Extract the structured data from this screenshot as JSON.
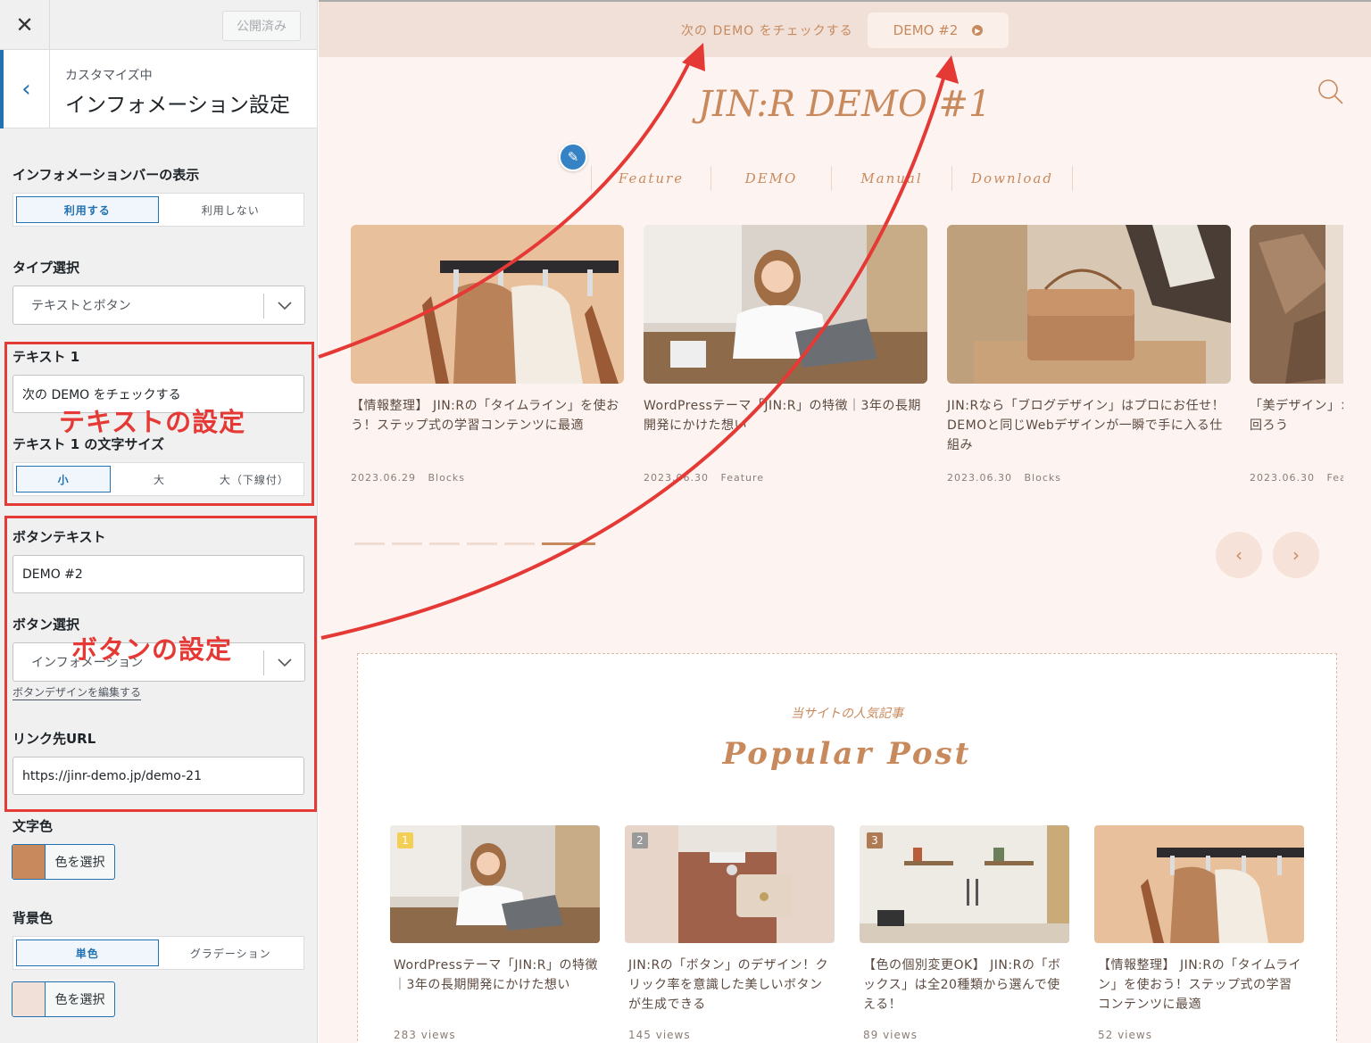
{
  "sidebar": {
    "close_icon": "close-icon",
    "publish_label": "公開済み",
    "customizing_label": "カスタマイズ中",
    "section_title": "インフォメーション設定",
    "info_bar_label": "インフォメーションバーの表示",
    "info_bar_options": [
      "利用する",
      "利用しない"
    ],
    "type_label": "タイプ選択",
    "type_value": "テキストとボタン",
    "text1_label": "テキスト 1",
    "text1_value": "次の DEMO をチェックする",
    "text1_size_label": "テキスト 1 の文字サイズ",
    "text1_size_options": [
      "小",
      "大",
      "大（下線付）"
    ],
    "button_text_label": "ボタンテキスト",
    "button_text_value": "DEMO #2",
    "button_select_label": "ボタン選択",
    "button_select_value": "インフォメーション",
    "edit_button_link": "ボタンデザインを編集する",
    "link_url_label": "リンク先URL",
    "link_url_value": "https://jinr-demo.jp/demo-21",
    "text_color_label": "文字色",
    "text_color": "#c8895c",
    "color_select_label": "色を選択",
    "bg_color_label": "背景色",
    "bg_options": [
      "単色",
      "グラデーション"
    ],
    "bg_color": "#f0e0d8"
  },
  "annotations": {
    "text_setting": "テキストの設定",
    "button_setting": "ボタンの設定",
    "color": "#e53935"
  },
  "preview": {
    "info_text": "次の DEMO をチェックする",
    "info_button": "DEMO #2",
    "logo": "JIN:R DEMO #1",
    "nav": [
      "Feature",
      "DEMO",
      "Manual",
      "Download"
    ],
    "posts": [
      {
        "title": "【情報整理】 JIN:Rの「タイムライン」を使おう！ステップ式の学習コンテンツに最適",
        "date": "2023.06.29",
        "category": "Blocks"
      },
      {
        "title": "WordPressテーマ「JIN:R」の特徴｜3年の長期開発にかけた想い",
        "date": "2023.06.30",
        "category": "Feature"
      },
      {
        "title": "JIN:Rなら「ブログデザイン」はプロにお任せ！DEMOと同じWebデザインが一瞬で手に入る仕組み",
        "date": "2023.06.30",
        "category": "Blocks"
      },
      {
        "title": "「美デザイン」×「速いサイト」で、有利に立ち回ろう",
        "date": "2023.06.30",
        "category": "Feature"
      }
    ],
    "popular_sub": "当サイトの人気記事",
    "popular_title": "Popular Post",
    "popular": [
      {
        "rank": "1",
        "title": "WordPressテーマ「JIN:R」の特徴｜3年の長期開発にかけた想い",
        "views": "283 views"
      },
      {
        "rank": "2",
        "title": "JIN:Rの「ボタン」のデザイン！クリック率を意識した美しいボタンが生成できる",
        "views": "145 views"
      },
      {
        "rank": "3",
        "title": "【色の個別変更OK】 JIN:Rの「ボックス」は全20種類から選んで使える！",
        "views": "89 views"
      },
      {
        "rank": "",
        "title": "【情報整理】 JIN:Rの「タイムライン」を使おう！ステップ式の学習コンテンツに最適",
        "views": "52 views"
      }
    ]
  }
}
